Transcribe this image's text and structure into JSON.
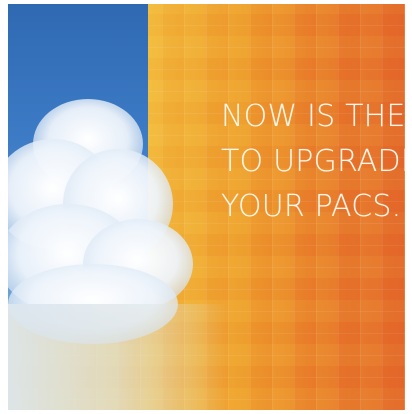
{
  "ad": {
    "headline_lines": [
      "NOW IS THE TIME",
      "TO UPGRADE",
      "YOUR PACS."
    ]
  },
  "colors": {
    "sky_blue": "#3d7bc6",
    "orange_start": "#f3c23a",
    "orange_end": "#e46a2a",
    "headline_text": "#fff7ea"
  },
  "imagery": {
    "left_image": "sky-with-cloud"
  }
}
